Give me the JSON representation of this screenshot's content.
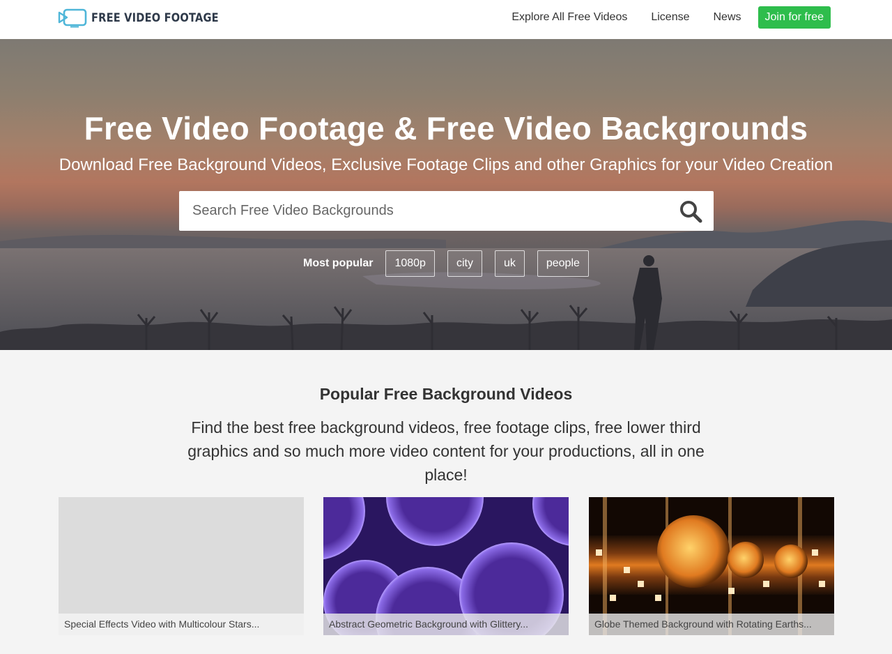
{
  "nav": {
    "logo_text": "FREE VIDEO FOOTAGE",
    "links": [
      "Explore All Free Videos",
      "License",
      "News"
    ],
    "join_label": "Join for free"
  },
  "hero": {
    "title": "Free Video Footage & Free Video Backgrounds",
    "subtitle": "Download Free Background Videos, Exclusive Footage Clips and other Graphics for your Video Creation",
    "search_placeholder": "Search Free Video Backgrounds",
    "popular_label": "Most popular",
    "tags": [
      "1080p",
      "city",
      "uk",
      "people"
    ]
  },
  "section": {
    "title": "Popular Free Background Videos",
    "description": "Find the best free background videos, free footage clips, free lower third graphics and so much more video content for your productions, all in one place!"
  },
  "cards": [
    "Special Effects Video with Multicolour Stars...",
    "Abstract Geometric Background with Glittery...",
    "Globe Themed Background with Rotating Earths..."
  ],
  "colors": {
    "accent_green": "#2ebd4c",
    "logo_blue": "#4fb6d8",
    "page_bg": "#f4f4f4"
  },
  "icons": {
    "logo": "video-camera-icon",
    "search": "search-icon"
  }
}
